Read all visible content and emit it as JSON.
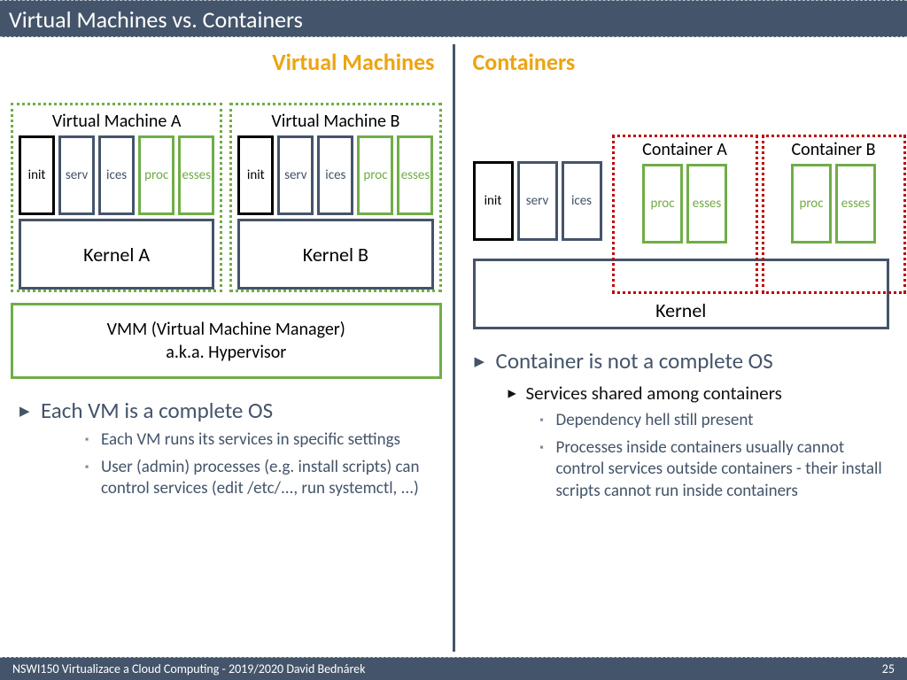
{
  "title": "Virtual Machines vs. Containers",
  "footer": {
    "left": "NSWI150 Virtualizace a Cloud Computing - 2019/2020 David Bednárek",
    "page": "25"
  },
  "left": {
    "heading": "Virtual Machines",
    "vmA": {
      "title": "Virtual Machine A",
      "p1": "init",
      "p2": "serv",
      "p3": "ices",
      "p4": "proc",
      "p5": "esses",
      "kernel": "Kernel A"
    },
    "vmB": {
      "title": "Virtual Machine B",
      "p1": "init",
      "p2": "serv",
      "p3": "ices",
      "p4": "proc",
      "p5": "esses",
      "kernel": "Kernel B"
    },
    "vmm1": "VMM (Virtual Machine Manager)",
    "vmm2": "a.k.a. Hypervisor",
    "b1": "Each VM is a complete OS",
    "b3a": "Each VM runs its services in specific settings",
    "b3b": "User (admin) processes (e.g. install scripts) can control services (edit /etc/..., run systemctl, ...)"
  },
  "right": {
    "heading": "Containers",
    "host": {
      "p1": "init",
      "p2": "serv",
      "p3": "ices"
    },
    "cA": {
      "title": "Container A",
      "p1": "proc",
      "p2": "esses"
    },
    "cB": {
      "title": "Container B",
      "p1": "proc",
      "p2": "esses"
    },
    "kernel": "Kernel",
    "b1": "Container is not a complete OS",
    "b2": "Services shared among containers",
    "b3a": "Dependency hell still present",
    "b3b": "Processes inside containers usually cannot control services outside containers - their install scripts cannot run inside containers"
  }
}
